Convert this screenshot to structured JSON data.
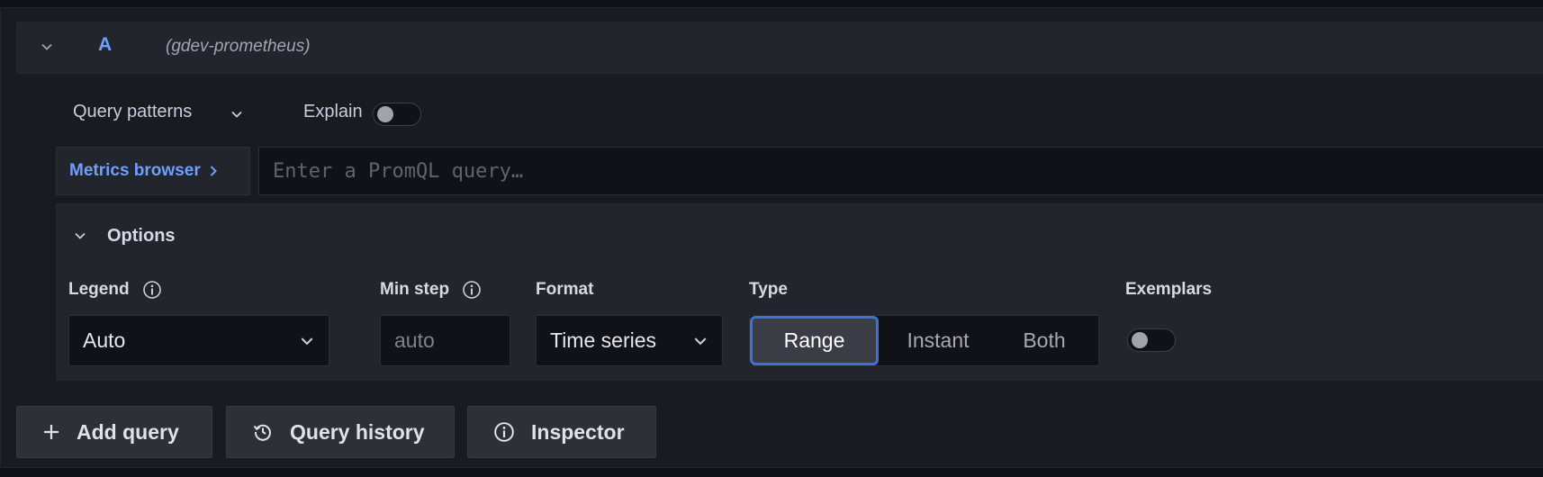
{
  "query": {
    "ref_id": "A",
    "datasource": "(gdev-prometheus)"
  },
  "toolbar": {
    "query_patterns_label": "Query patterns",
    "explain_label": "Explain",
    "explain_enabled": false
  },
  "query_row": {
    "metrics_browser_label": "Metrics browser",
    "query_placeholder": "Enter a PromQL query…",
    "query_value": ""
  },
  "options": {
    "title": "Options",
    "legend": {
      "label": "Legend",
      "value": "Auto"
    },
    "min_step": {
      "label": "Min step",
      "placeholder": "auto",
      "value": ""
    },
    "format": {
      "label": "Format",
      "value": "Time series"
    },
    "type": {
      "label": "Type",
      "options": [
        "Range",
        "Instant",
        "Both"
      ],
      "selected": "Range"
    },
    "exemplars": {
      "label": "Exemplars",
      "enabled": false
    }
  },
  "actions": {
    "add_query": "Add query",
    "query_history": "Query history",
    "inspector": "Inspector"
  },
  "colors": {
    "accent_link": "#6e9fff",
    "active_border": "#3d71d9",
    "background": "#111217",
    "panel": "#22252b"
  },
  "icons": {
    "collapse": "chevron-down-icon",
    "query_patterns": "chevron-down-icon",
    "metrics_browser": "chevron-right-icon",
    "info": "info-circle-icon",
    "add": "plus-icon",
    "history": "history-icon",
    "inspector": "info-circle-icon"
  }
}
